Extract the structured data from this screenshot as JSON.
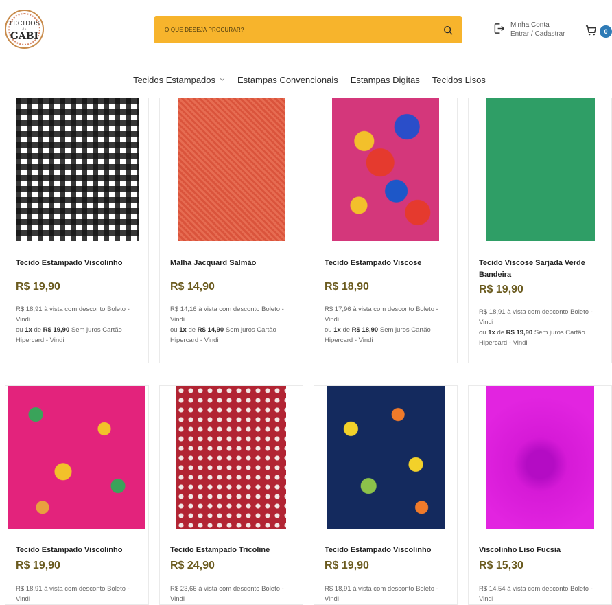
{
  "header": {
    "logo": {
      "line1": "TECIDOS",
      "line2": "da",
      "line3": "GABI"
    },
    "search": {
      "placeholder": "O QUE DESEJA PROCURAR?"
    },
    "account": {
      "line1": "Minha Conta",
      "line2": "Entrar / Cadastrar"
    },
    "cart": {
      "count": "0"
    }
  },
  "nav": {
    "items": [
      {
        "label": "Tecidos Estampados",
        "has_dropdown": true
      },
      {
        "label": "Estampas Convencionais"
      },
      {
        "label": "Estampas Digitas"
      },
      {
        "label": "Tecidos Lisos"
      }
    ]
  },
  "products": [
    {
      "name": "Tecido Estampado Viscolinho",
      "price": "R$ 19,90",
      "cash": "R$ 18,91 à vista com desconto Boleto - Vindi",
      "inst_prefix": "ou",
      "inst_count": "1x",
      "inst_mid": "de",
      "inst_value": "R$ 19,90",
      "inst_suffix": "Sem juros Cartão Hipercard - Vindi"
    },
    {
      "name": "Malha Jacquard Salmão",
      "price": "R$ 14,90",
      "cash": "R$ 14,16 à vista com desconto Boleto - Vindi",
      "inst_prefix": "ou",
      "inst_count": "1x",
      "inst_mid": "de",
      "inst_value": "R$ 14,90",
      "inst_suffix": "Sem juros Cartão Hipercard - Vindi"
    },
    {
      "name": "Tecido Estampado Viscose",
      "price": "R$ 18,90",
      "cash": "R$ 17,96 à vista com desconto Boleto - Vindi",
      "inst_prefix": "ou",
      "inst_count": "1x",
      "inst_mid": "de",
      "inst_value": "R$ 18,90",
      "inst_suffix": "Sem juros Cartão Hipercard - Vindi"
    },
    {
      "name": "Tecido Viscose Sarjada Verde Bandeira",
      "price": "R$ 19,90",
      "cash": "R$ 18,91 à vista com desconto Boleto - Vindi",
      "inst_prefix": "ou",
      "inst_count": "1x",
      "inst_mid": "de",
      "inst_value": "R$ 19,90",
      "inst_suffix": "Sem juros Cartão Hipercard - Vindi"
    },
    {
      "name": "Tecido Estampado Viscolinho",
      "price": "R$ 19,90",
      "cash": "R$ 18,91 à vista com desconto Boleto - Vindi"
    },
    {
      "name": "Tecido Estampado Tricoline",
      "price": "R$ 24,90",
      "cash": "R$ 23,66 à vista com desconto Boleto - Vindi"
    },
    {
      "name": "Tecido Estampado Viscolinho",
      "price": "R$ 19,90",
      "cash": "R$ 18,91 à vista com desconto Boleto - Vindi"
    },
    {
      "name": "Viscolinho Liso Fucsia",
      "price": "R$ 15,30",
      "cash": "R$ 14,54 à vista com desconto Boleto - Vindi"
    }
  ],
  "colors": {
    "accent": "#f7b42c",
    "price": "#6b5b1f",
    "badge": "#2e7bb6",
    "divider": "#d9b24a"
  },
  "icons": [
    "search-icon",
    "login-icon",
    "cart-icon",
    "chevron-down-icon"
  ]
}
